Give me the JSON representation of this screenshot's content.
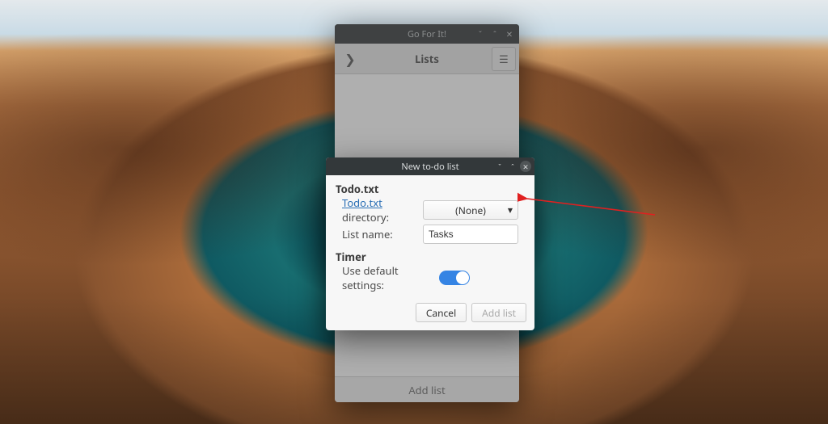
{
  "parent_window": {
    "title": "Go For It!",
    "toolbar_title": "Lists",
    "add_list_label": "Add list"
  },
  "dialog": {
    "title": "New to-do list",
    "section_todo": "Todo.txt",
    "directory_link": "Todo.txt",
    "directory_rest": " directory:",
    "directory_value": "(None)",
    "list_name_label": "List name:",
    "list_name_value": "Tasks",
    "section_timer": "Timer",
    "use_default_label": "Use default settings:",
    "cancel_label": "Cancel",
    "add_list_label": "Add list"
  }
}
